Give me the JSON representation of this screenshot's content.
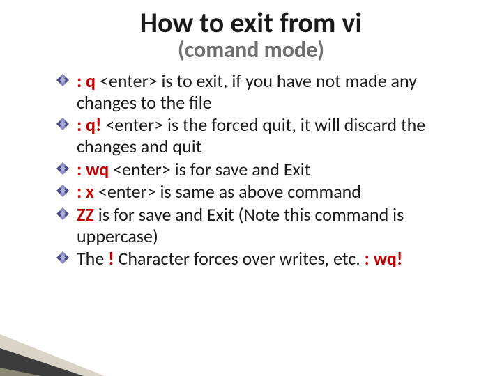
{
  "title": "How to exit from vi",
  "subtitle": "(comand mode)",
  "bullets": [
    {
      "cmd": ": q",
      "enter": " <enter> ",
      "rest": "is to exit, if you have not made any changes to the file"
    },
    {
      "cmd": ": q!",
      "enter": " <enter> ",
      "rest": "is the forced quit, it will discard the changes and quit"
    },
    {
      "cmd": ": wq",
      "enter": " <enter> ",
      "rest": "is for save and Exit"
    },
    {
      "cmd": ": x",
      "enter": " <enter> ",
      "rest": "is same as above command"
    },
    {
      "cmd": "ZZ",
      "enter": " ",
      "rest": "is for save and Exit (Note this command is uppercase)"
    }
  ],
  "last": {
    "prefix": "The ",
    "bang": "!",
    "mid": " Character forces over writes, etc. ",
    "tail": ": wq!"
  }
}
